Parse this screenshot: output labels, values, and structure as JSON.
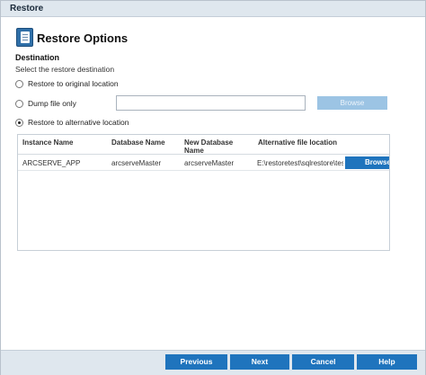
{
  "window": {
    "title": "Restore"
  },
  "header": {
    "title": "Restore Options",
    "icon": "restore-options-icon"
  },
  "destination": {
    "label": "Destination",
    "subtitle": "Select the restore destination",
    "options": [
      {
        "label": "Restore to original location",
        "checked": false
      },
      {
        "label": "Dump file only",
        "checked": false
      },
      {
        "label": "Restore to alternative location",
        "checked": true
      }
    ],
    "dump_path_value": "",
    "dump_browse_label": "Browse"
  },
  "grid": {
    "columns": [
      "Instance Name",
      "Database Name",
      "New Database Name",
      "Alternative file location"
    ],
    "rows": [
      {
        "instance": "ARCSERVE_APP",
        "database": "arcserveMaster",
        "new_database": "arcserveMaster",
        "location": "E:\\restoretest\\sqlrestore\\test",
        "browse_label": "Browse"
      }
    ]
  },
  "footer": {
    "previous": "Previous",
    "next": "Next",
    "cancel": "Cancel",
    "help": "Help"
  },
  "colors": {
    "accent": "#1f74bd",
    "disabled_button": "#9cc4e4",
    "chrome": "#dfe7ee"
  }
}
